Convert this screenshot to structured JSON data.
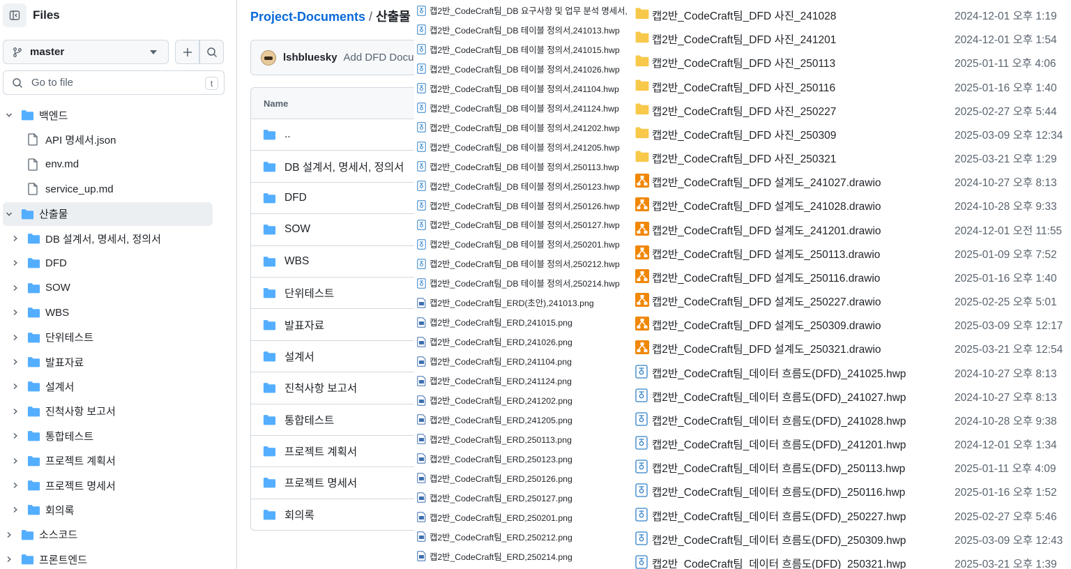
{
  "sidebar": {
    "title": "Files",
    "branch": "master",
    "goto_placeholder": "Go to file",
    "goto_shortcut": "t",
    "tree": [
      {
        "label": "백엔드",
        "type": "folder",
        "level": 0,
        "expanded": true
      },
      {
        "label": "API 명세서.json",
        "type": "file",
        "level": 1
      },
      {
        "label": "env.md",
        "type": "file",
        "level": 1
      },
      {
        "label": "service_up.md",
        "type": "file",
        "level": 1
      },
      {
        "label": "산출물",
        "type": "folder",
        "level": 0,
        "expanded": true,
        "active": true
      },
      {
        "label": "DB 설계서, 명세서, 정의서",
        "type": "folder",
        "level": 1
      },
      {
        "label": "DFD",
        "type": "folder",
        "level": 1
      },
      {
        "label": "SOW",
        "type": "folder",
        "level": 1
      },
      {
        "label": "WBS",
        "type": "folder",
        "level": 1
      },
      {
        "label": "단위테스트",
        "type": "folder",
        "level": 1
      },
      {
        "label": "발표자료",
        "type": "folder",
        "level": 1
      },
      {
        "label": "설계서",
        "type": "folder",
        "level": 1
      },
      {
        "label": "진척사항 보고서",
        "type": "folder",
        "level": 1
      },
      {
        "label": "통합테스트",
        "type": "folder",
        "level": 1
      },
      {
        "label": "프로젝트 계획서",
        "type": "folder",
        "level": 1
      },
      {
        "label": "프로젝트 명세서",
        "type": "folder",
        "level": 1
      },
      {
        "label": "회의록",
        "type": "folder",
        "level": 1
      },
      {
        "label": "소스코드",
        "type": "folder",
        "level": 0
      },
      {
        "label": "프론트엔드",
        "type": "folder",
        "level": 0
      }
    ]
  },
  "main": {
    "breadcrumb_repo": "Project-Documents",
    "breadcrumb_sep": "/",
    "breadcrumb_current": "산출물",
    "commit_author": "lshbluesky",
    "commit_message": "Add DFD Documents",
    "table_header": "Name",
    "rows": [
      "..",
      "DB 설계서, 명세서, 정의서",
      "DFD",
      "SOW",
      "WBS",
      "단위테스트",
      "발표자료",
      "설계서",
      "진척사항 보고서",
      "통합테스트",
      "프로젝트 계획서",
      "프로젝트 명세서",
      "회의록"
    ]
  },
  "overlay_files": [
    {
      "name": "캡2반_CodeCraft팀_DB 요구사항 및 업무 분석 명세서,",
      "icon": "hwp-icon"
    },
    {
      "name": "캡2반_CodeCraft팀_DB 테이블 정의서,241013.hwp",
      "icon": "hwp-icon"
    },
    {
      "name": "캡2반_CodeCraft팀_DB 테이블 정의서,241015.hwp",
      "icon": "hwp-icon"
    },
    {
      "name": "캡2반_CodeCraft팀_DB 테이블 정의서,241026.hwp",
      "icon": "hwp-icon"
    },
    {
      "name": "캡2반_CodeCraft팀_DB 테이블 정의서,241104.hwp",
      "icon": "hwp-icon"
    },
    {
      "name": "캡2반_CodeCraft팀_DB 테이블 정의서,241124.hwp",
      "icon": "hwp-icon"
    },
    {
      "name": "캡2반_CodeCraft팀_DB 테이블 정의서,241202.hwp",
      "icon": "hwp-icon"
    },
    {
      "name": "캡2반_CodeCraft팀_DB 테이블 정의서,241205.hwp",
      "icon": "hwp-icon"
    },
    {
      "name": "캡2반_CodeCraft팀_DB 테이블 정의서,250113.hwp",
      "icon": "hwp-icon"
    },
    {
      "name": "캡2반_CodeCraft팀_DB 테이블 정의서,250123.hwp",
      "icon": "hwp-icon"
    },
    {
      "name": "캡2반_CodeCraft팀_DB 테이블 정의서,250126.hwp",
      "icon": "hwp-icon"
    },
    {
      "name": "캡2반_CodeCraft팀_DB 테이블 정의서,250127.hwp",
      "icon": "hwp-icon"
    },
    {
      "name": "캡2반_CodeCraft팀_DB 테이블 정의서,250201.hwp",
      "icon": "hwp-icon"
    },
    {
      "name": "캡2반_CodeCraft팀_DB 테이블 정의서,250212.hwp",
      "icon": "hwp-icon"
    },
    {
      "name": "캡2반_CodeCraft팀_DB 테이블 정의서,250214.hwp",
      "icon": "hwp-icon"
    },
    {
      "name": "캡2반_CodeCraft팀_ERD(초안),241013.png",
      "icon": "png-icon"
    },
    {
      "name": "캡2반_CodeCraft팀_ERD,241015.png",
      "icon": "png-icon"
    },
    {
      "name": "캡2반_CodeCraft팀_ERD,241026.png",
      "icon": "png-icon"
    },
    {
      "name": "캡2반_CodeCraft팀_ERD,241104.png",
      "icon": "png-icon"
    },
    {
      "name": "캡2반_CodeCraft팀_ERD,241124.png",
      "icon": "png-icon"
    },
    {
      "name": "캡2반_CodeCraft팀_ERD,241202.png",
      "icon": "png-icon"
    },
    {
      "name": "캡2반_CodeCraft팀_ERD,241205.png",
      "icon": "png-icon"
    },
    {
      "name": "캡2반_CodeCraft팀_ERD,250113.png",
      "icon": "png-icon"
    },
    {
      "name": "캡2반_CodeCraft팀_ERD,250123.png",
      "icon": "png-icon"
    },
    {
      "name": "캡2반_CodeCraft팀_ERD,250126.png",
      "icon": "png-icon"
    },
    {
      "name": "캡2반_CodeCraft팀_ERD,250127.png",
      "icon": "png-icon"
    },
    {
      "name": "캡2반_CodeCraft팀_ERD,250201.png",
      "icon": "png-icon"
    },
    {
      "name": "캡2반_CodeCraft팀_ERD,250212.png",
      "icon": "png-icon"
    },
    {
      "name": "캡2반_CodeCraft팀_ERD,250214.png",
      "icon": "png-icon"
    }
  ],
  "right_files": [
    {
      "name": "캡2반_CodeCraft팀_DFD 사진_241028",
      "date": "2024-12-01 오후 1:19",
      "icon": "folder-icon"
    },
    {
      "name": "캡2반_CodeCraft팀_DFD 사진_241201",
      "date": "2024-12-01 오후 1:54",
      "icon": "folder-icon"
    },
    {
      "name": "캡2반_CodeCraft팀_DFD 사진_250113",
      "date": "2025-01-11 오후 4:06",
      "icon": "folder-icon"
    },
    {
      "name": "캡2반_CodeCraft팀_DFD 사진_250116",
      "date": "2025-01-16 오후 1:40",
      "icon": "folder-icon"
    },
    {
      "name": "캡2반_CodeCraft팀_DFD 사진_250227",
      "date": "2025-02-27 오후 5:44",
      "icon": "folder-icon"
    },
    {
      "name": "캡2반_CodeCraft팀_DFD 사진_250309",
      "date": "2025-03-09 오후 12:34",
      "icon": "folder-icon"
    },
    {
      "name": "캡2반_CodeCraft팀_DFD 사진_250321",
      "date": "2025-03-21 오후 1:29",
      "icon": "folder-icon"
    },
    {
      "name": "캡2반_CodeCraft팀_DFD 설계도_241027.drawio",
      "date": "2024-10-27 오후 8:13",
      "icon": "drawio-icon"
    },
    {
      "name": "캡2반_CodeCraft팀_DFD 설계도_241028.drawio",
      "date": "2024-10-28 오후 9:33",
      "icon": "drawio-icon"
    },
    {
      "name": "캡2반_CodeCraft팀_DFD 설계도_241201.drawio",
      "date": "2024-12-01 오전 11:55",
      "icon": "drawio-icon"
    },
    {
      "name": "캡2반_CodeCraft팀_DFD 설계도_250113.drawio",
      "date": "2025-01-09 오후 7:52",
      "icon": "drawio-icon"
    },
    {
      "name": "캡2반_CodeCraft팀_DFD 설계도_250116.drawio",
      "date": "2025-01-16 오후 1:40",
      "icon": "drawio-icon"
    },
    {
      "name": "캡2반_CodeCraft팀_DFD 설계도_250227.drawio",
      "date": "2025-02-25 오후 5:01",
      "icon": "drawio-icon"
    },
    {
      "name": "캡2반_CodeCraft팀_DFD 설계도_250309.drawio",
      "date": "2025-03-09 오후 12:17",
      "icon": "drawio-icon"
    },
    {
      "name": "캡2반_CodeCraft팀_DFD 설계도_250321.drawio",
      "date": "2025-03-21 오후 12:54",
      "icon": "drawio-icon"
    },
    {
      "name": "캡2반_CodeCraft팀_데이터 흐름도(DFD)_241025.hwp",
      "date": "2024-10-27 오후 8:13",
      "icon": "hwp-icon"
    },
    {
      "name": "캡2반_CodeCraft팀_데이터 흐름도(DFD)_241027.hwp",
      "date": "2024-10-27 오후 8:13",
      "icon": "hwp-icon"
    },
    {
      "name": "캡2반_CodeCraft팀_데이터 흐름도(DFD)_241028.hwp",
      "date": "2024-10-28 오후 9:38",
      "icon": "hwp-icon"
    },
    {
      "name": "캡2반_CodeCraft팀_데이터 흐름도(DFD)_241201.hwp",
      "date": "2024-12-01 오후 1:34",
      "icon": "hwp-icon"
    },
    {
      "name": "캡2반_CodeCraft팀_데이터 흐름도(DFD)_250113.hwp",
      "date": "2025-01-11 오후 4:09",
      "icon": "hwp-icon"
    },
    {
      "name": "캡2반_CodeCraft팀_데이터 흐름도(DFD)_250116.hwp",
      "date": "2025-01-16 오후 1:52",
      "icon": "hwp-icon"
    },
    {
      "name": "캡2반_CodeCraft팀_데이터 흐름도(DFD)_250227.hwp",
      "date": "2025-02-27 오후 5:46",
      "icon": "hwp-icon"
    },
    {
      "name": "캡2반_CodeCraft팀_데이터 흐름도(DFD)_250309.hwp",
      "date": "2025-03-09 오후 12:43",
      "icon": "hwp-icon"
    },
    {
      "name": "캡2반_CodeCraft팀_데이터 흐름도(DFD)_250321.hwp",
      "date": "2025-03-21 오후 1:39",
      "icon": "hwp-icon"
    }
  ],
  "colors": {
    "folder_blue": "#54aeff",
    "folder_yellow": "#f8c84a",
    "drawio_orange": "#f08705",
    "hwp_blue": "#2f80c8",
    "link": "#0969da"
  }
}
